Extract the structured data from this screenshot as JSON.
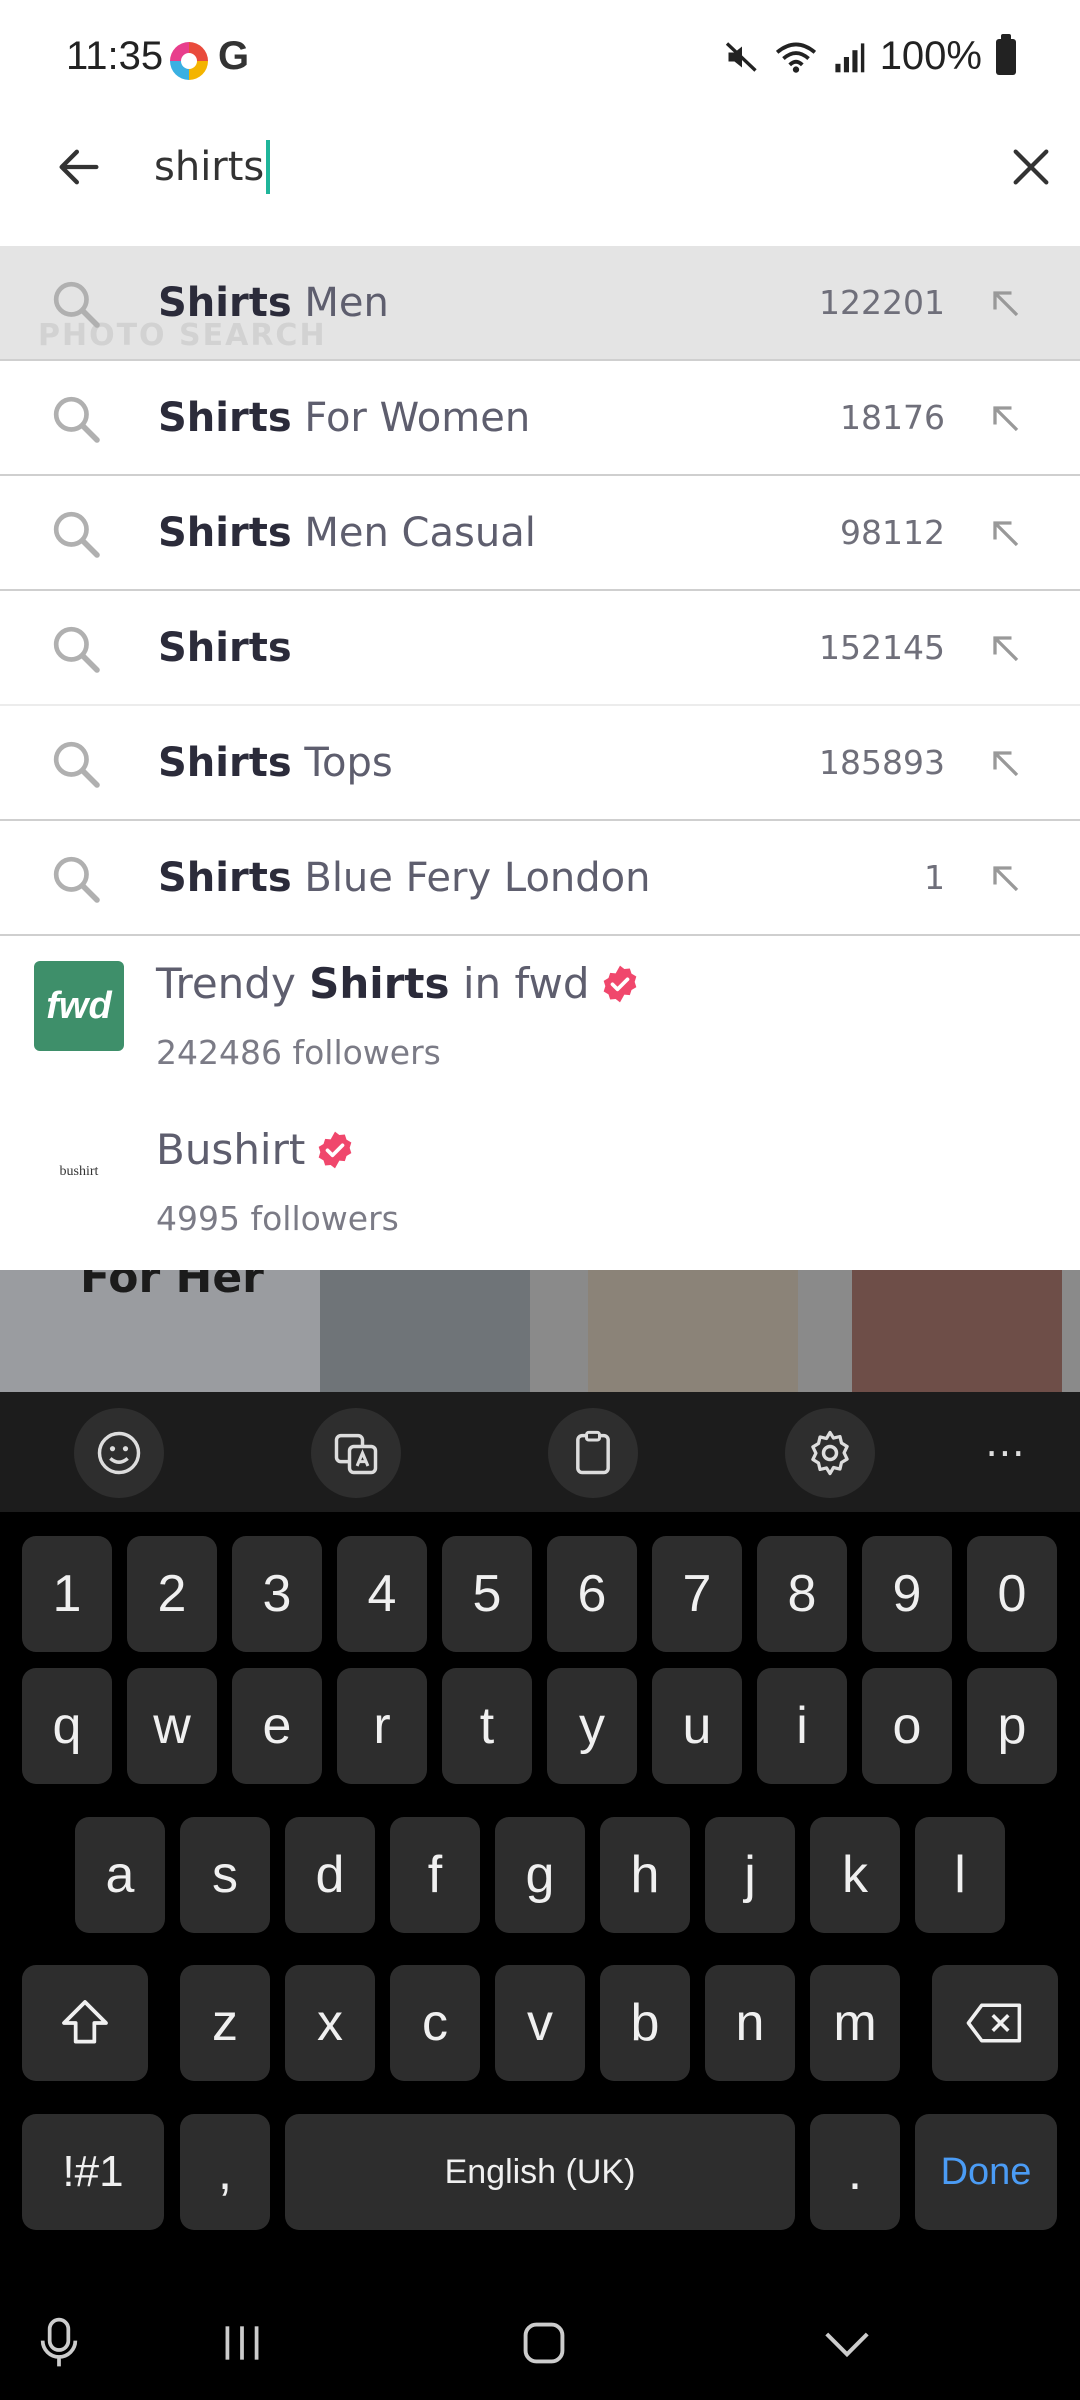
{
  "status_bar": {
    "time": "11:35",
    "app_letter": "G",
    "battery": "100%"
  },
  "search": {
    "query": "shirts"
  },
  "suggestions": [
    {
      "bold": "Shirts",
      "rest": " Men",
      "count": "122201"
    },
    {
      "bold": "Shirts",
      "rest": " For Women",
      "count": "18176"
    },
    {
      "bold": "Shirts",
      "rest": " Men Casual",
      "count": "98112"
    },
    {
      "bold": "Shirts",
      "rest": "",
      "count": "152145"
    },
    {
      "bold": "Shirts",
      "rest": " Tops",
      "count": "185893"
    },
    {
      "bold": "Shirts",
      "rest": " Blue Fery London",
      "count": "1"
    }
  ],
  "background_text": {
    "photo_search": "PHOTO SEARCH",
    "for_her": "For Her"
  },
  "stores": [
    {
      "prefix": "Trendy ",
      "bold": "Shirts",
      "suffix": " in fwd",
      "followers": "242486 followers",
      "logo_text": "fwd"
    },
    {
      "prefix": "Bushirt",
      "bold": "",
      "suffix": "",
      "followers": "4995 followers",
      "logo_text": "bushirt"
    }
  ],
  "keyboard": {
    "number_row": [
      "1",
      "2",
      "3",
      "4",
      "5",
      "6",
      "7",
      "8",
      "9",
      "0"
    ],
    "row1": [
      "q",
      "w",
      "e",
      "r",
      "t",
      "y",
      "u",
      "i",
      "o",
      "p"
    ],
    "row2": [
      "a",
      "s",
      "d",
      "f",
      "g",
      "h",
      "j",
      "k",
      "l"
    ],
    "row3": [
      "z",
      "x",
      "c",
      "v",
      "b",
      "n",
      "m"
    ],
    "symbols_label": "!#1",
    "comma": ",",
    "space_label": "English (UK)",
    "period": ".",
    "done_label": "Done",
    "toolbar_more": "⋯"
  },
  "colors": {
    "accent_caret": "#1fb59a",
    "verified_badge": "#f0476c",
    "fwd_logo": "#3e8f6a",
    "done_text": "#4b9cf5"
  }
}
